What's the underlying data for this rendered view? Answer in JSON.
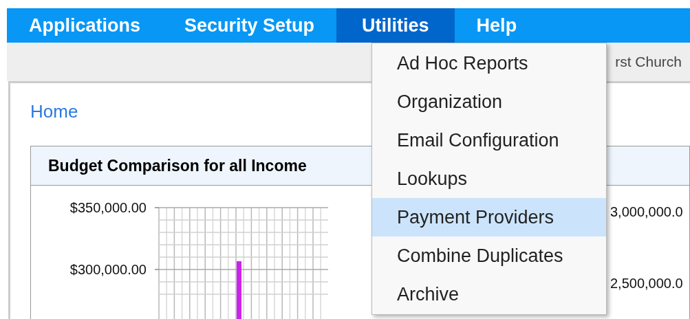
{
  "nav": {
    "items": [
      {
        "label": "Applications",
        "selected": false
      },
      {
        "label": "Security Setup",
        "selected": false
      },
      {
        "label": "Utilities",
        "selected": true
      },
      {
        "label": "Help",
        "selected": false
      }
    ]
  },
  "subbar": {
    "organization": "rst Church"
  },
  "breadcrumb": "Home",
  "panel": {
    "title": "Budget Comparison for all Income",
    "left_axis_labels": [
      "$350,000.00",
      "$300,000.00"
    ],
    "right_axis_labels": [
      "3,000,000.0",
      "2,500,000.0"
    ]
  },
  "dropdown": {
    "items": [
      {
        "label": "Ad Hoc Reports",
        "selected": false
      },
      {
        "label": "Organization",
        "selected": false
      },
      {
        "label": "Email Configuration",
        "selected": false
      },
      {
        "label": "Lookups",
        "selected": false
      },
      {
        "label": "Payment Providers",
        "selected": true
      },
      {
        "label": "Combine Duplicates",
        "selected": false
      },
      {
        "label": "Archive",
        "selected": false
      }
    ]
  }
}
